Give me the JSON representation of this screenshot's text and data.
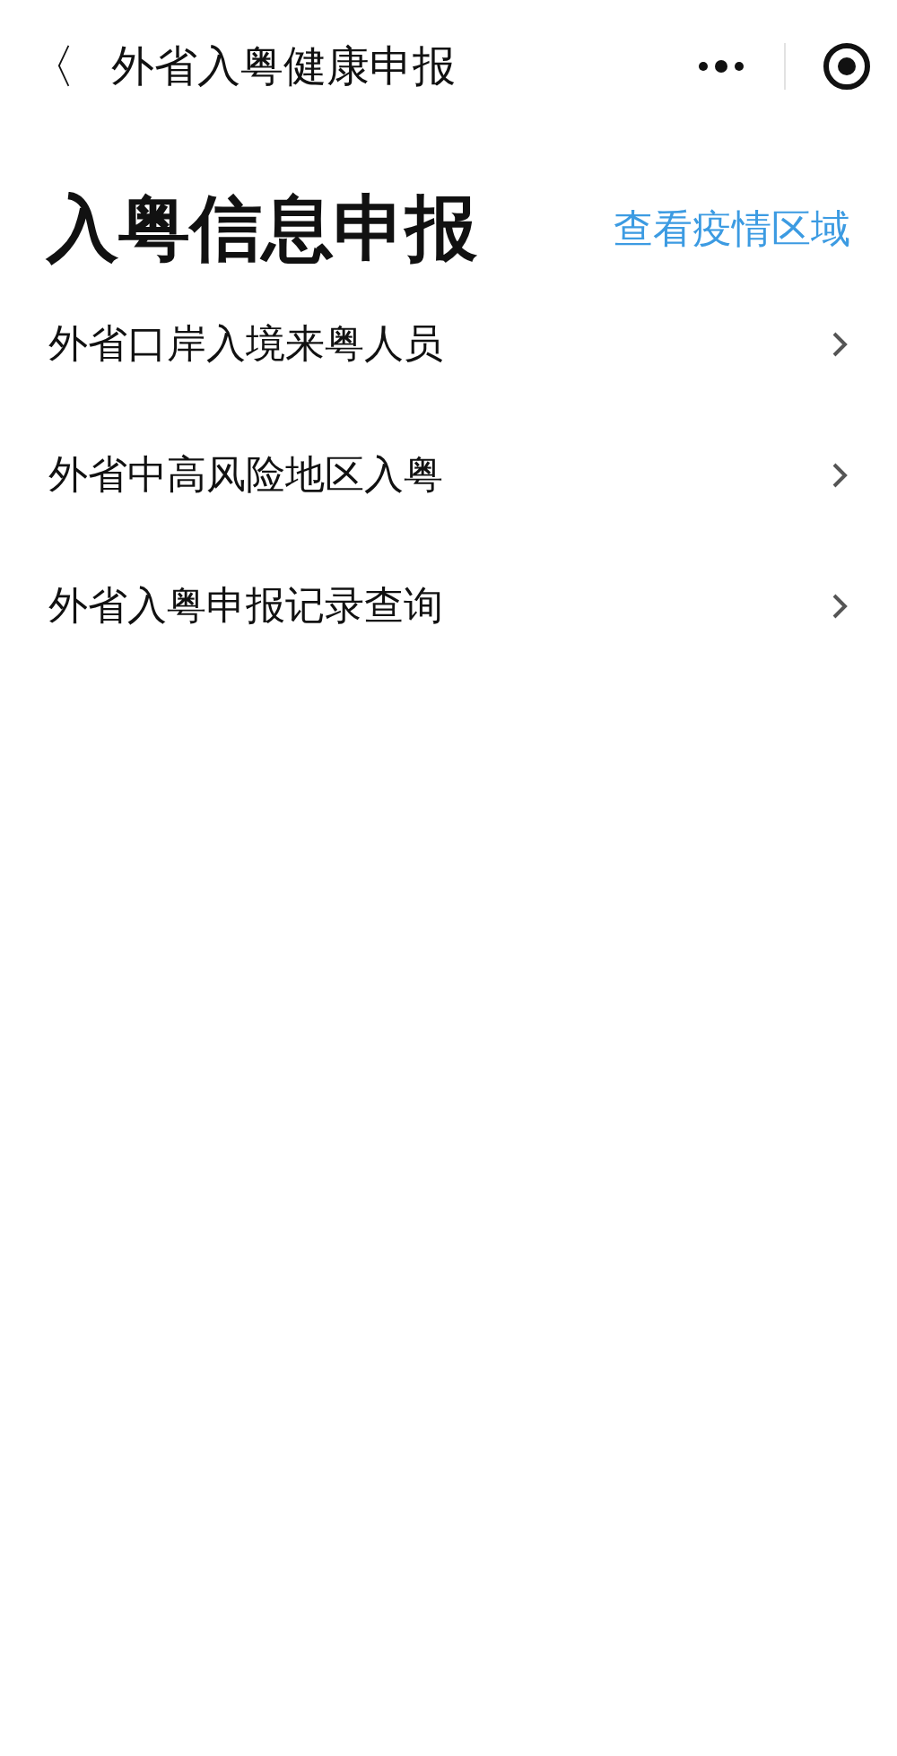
{
  "nav_bar": {
    "back": "〈",
    "title": "外省入粤健康申报"
  },
  "heading": {
    "title": "入粤信息申报",
    "link": "查看疫情区域"
  },
  "menu_items": [
    {
      "label": "外省口岸入境来粤人员"
    },
    {
      "label": "外省中高风险地区入粤"
    },
    {
      "label": "外省入粤申报记录查询"
    }
  ]
}
